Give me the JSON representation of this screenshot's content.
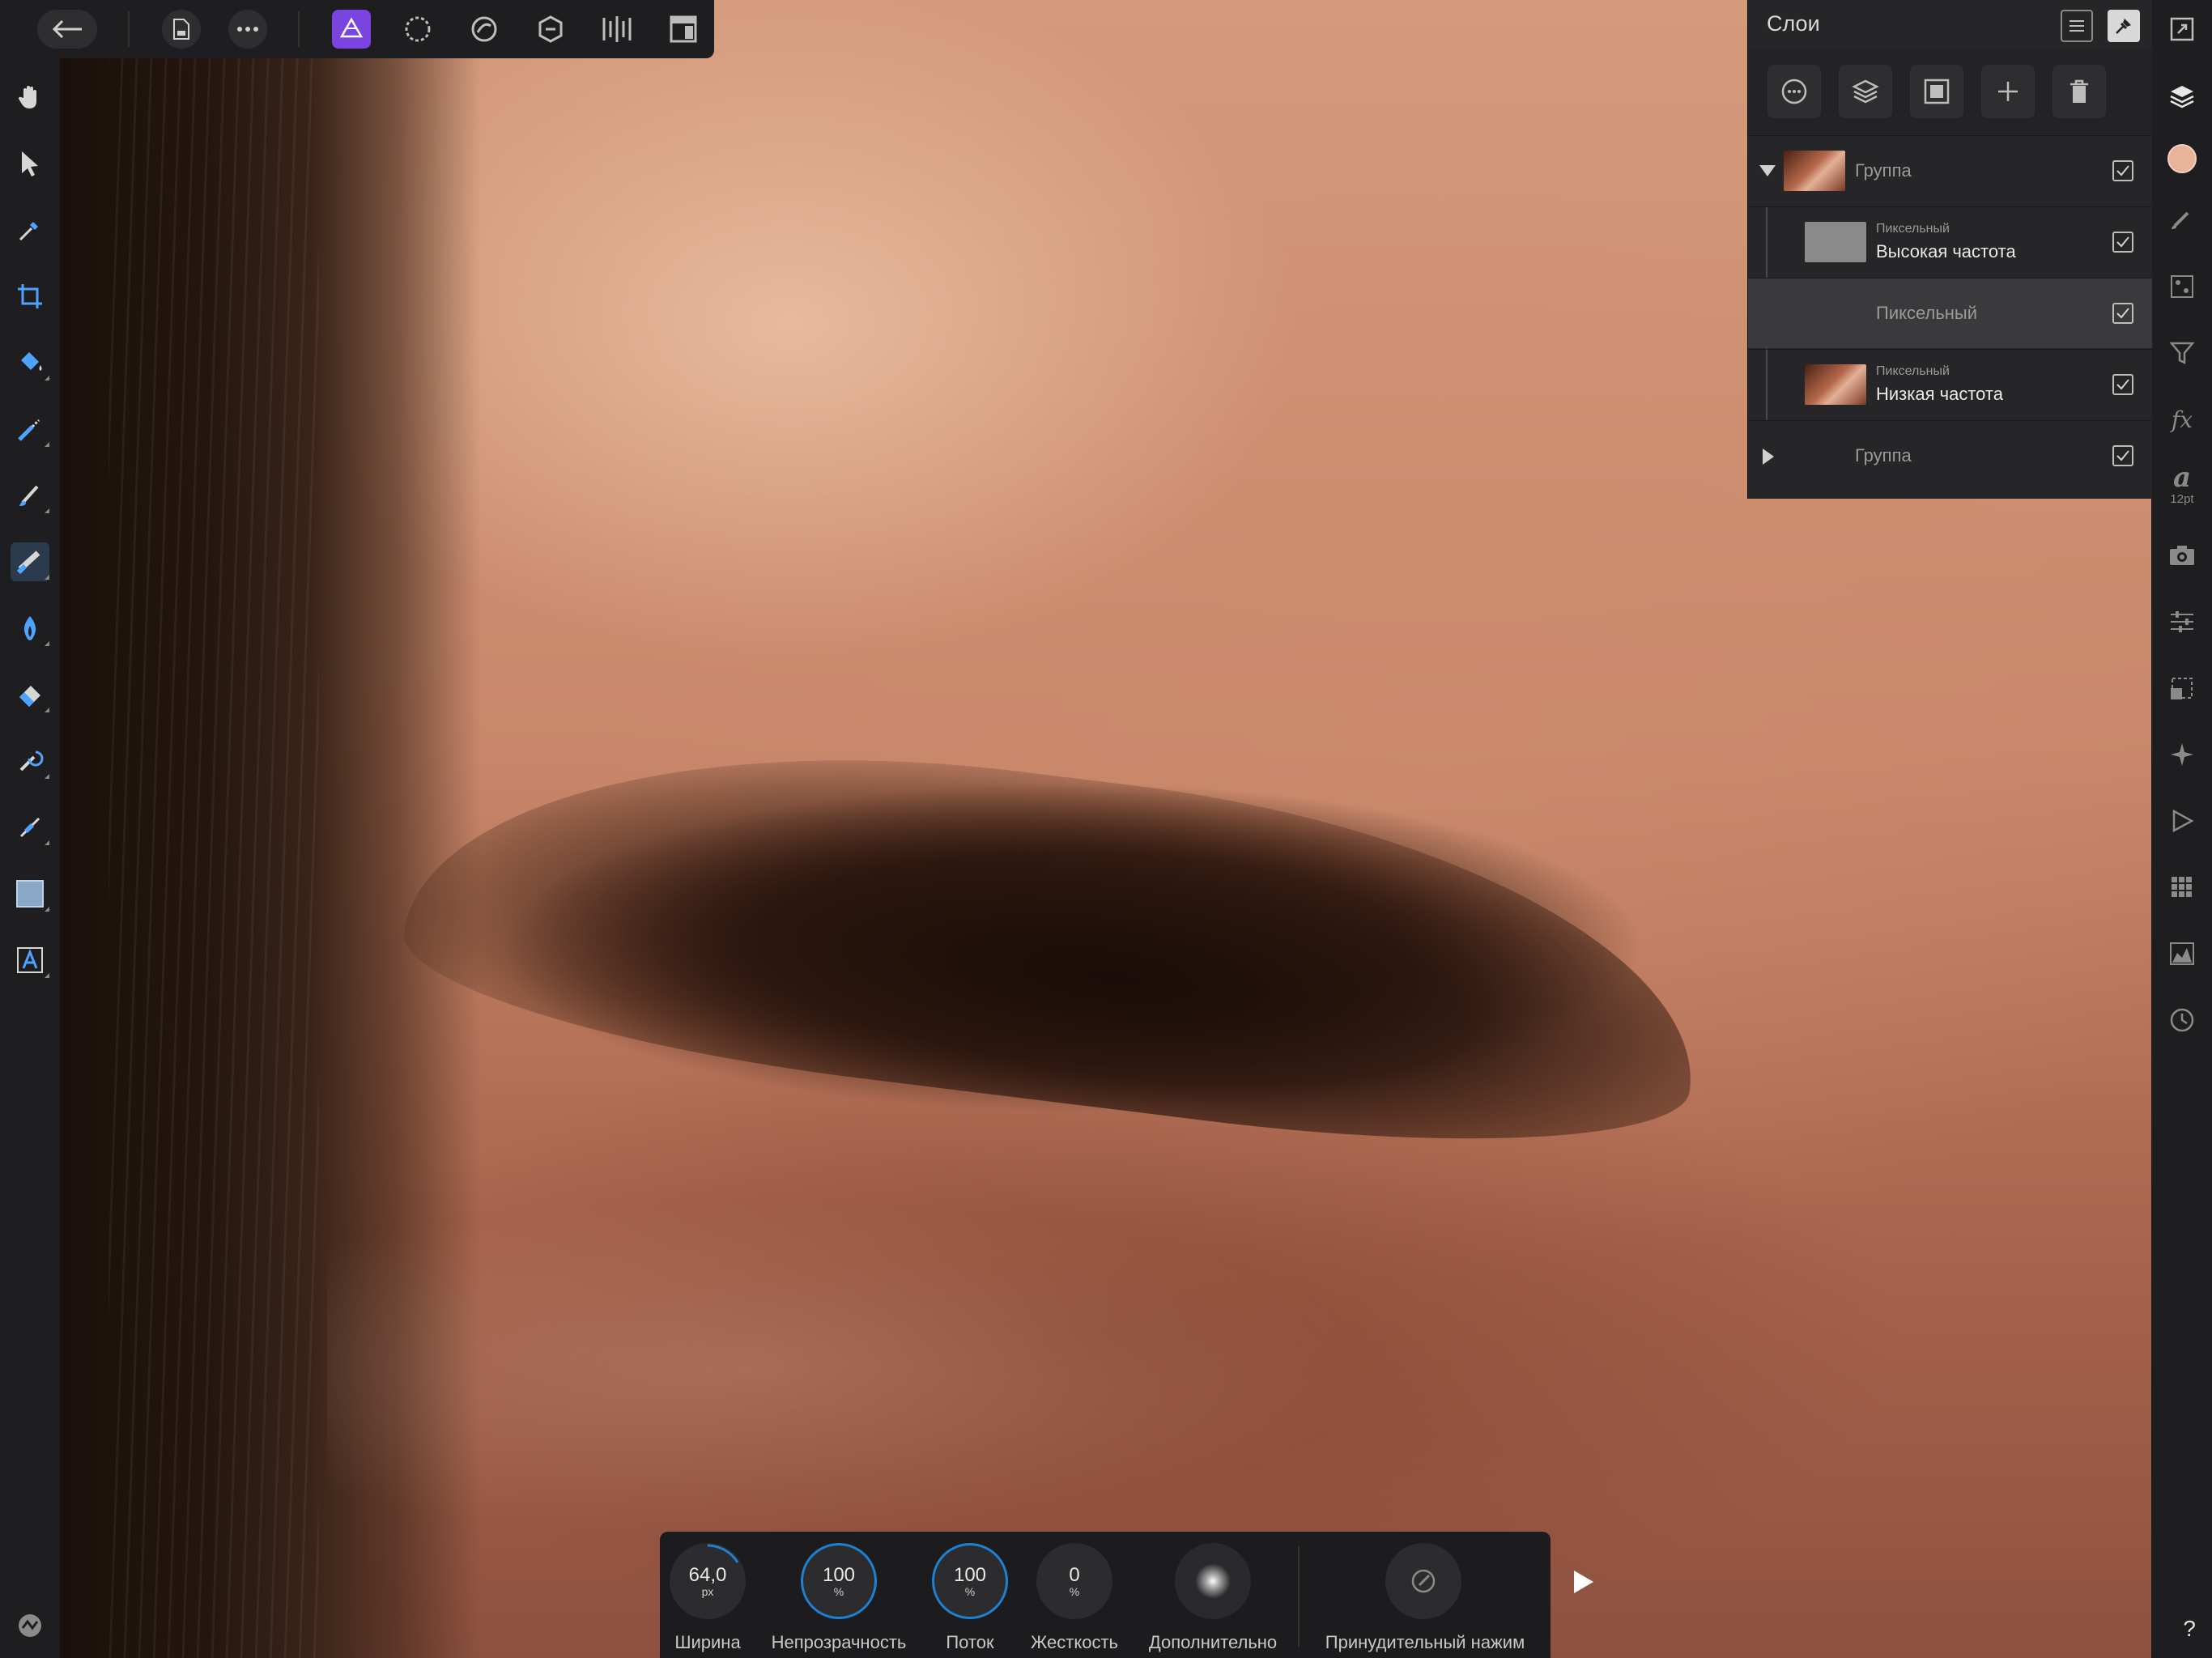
{
  "top_toolbar": {
    "back": "back-arrow-icon",
    "document": "document-icon",
    "more": "more-icon",
    "personas": [
      "photo-persona-icon",
      "liquify-persona-icon",
      "develop-persona-icon",
      "tone-mapping-persona-icon",
      "export-persona-icon"
    ],
    "view_mode": "view-mode-icon"
  },
  "left_tools": [
    "hand-tool-icon",
    "move-tool-icon",
    "color-picker-icon",
    "crop-tool-icon",
    "flood-fill-icon",
    "selection-brush-icon",
    "paint-brush-icon",
    "inpainting-brush-icon",
    "burn-tool-icon",
    "erase-tool-icon",
    "clone-brush-icon",
    "pen-tool-icon",
    "shape-tool-icon",
    "text-tool-icon"
  ],
  "layers": {
    "title": "Слои",
    "rows": [
      {
        "type": "",
        "name": "Группа",
        "dim": true,
        "expanded": true,
        "visible": true
      },
      {
        "type": "Пиксельный",
        "name": "Высокая частота",
        "visible": true
      },
      {
        "type": "",
        "name": "Пиксельный",
        "dim": true,
        "selected": true,
        "visible": true
      },
      {
        "type": "Пиксельный",
        "name": "Низкая частота",
        "visible": true
      },
      {
        "type": "",
        "name": "Группа",
        "dim": true,
        "expanded": false,
        "visible": true
      }
    ]
  },
  "right_strip": {
    "text_size": "12pt",
    "color_swatch": "#e9b39a"
  },
  "context_bar": {
    "width": {
      "value": "64,0",
      "unit": "px",
      "label": "Ширина"
    },
    "opacity": {
      "value": "100",
      "unit": "%",
      "label": "Непрозрачность"
    },
    "flow": {
      "value": "100",
      "unit": "%",
      "label": "Поток"
    },
    "hardness": {
      "value": "0",
      "unit": "%",
      "label": "Жесткость"
    },
    "advanced": {
      "label": "Дополнительно"
    },
    "force_pressure": {
      "label": "Принудительный нажим"
    }
  },
  "help": "?"
}
